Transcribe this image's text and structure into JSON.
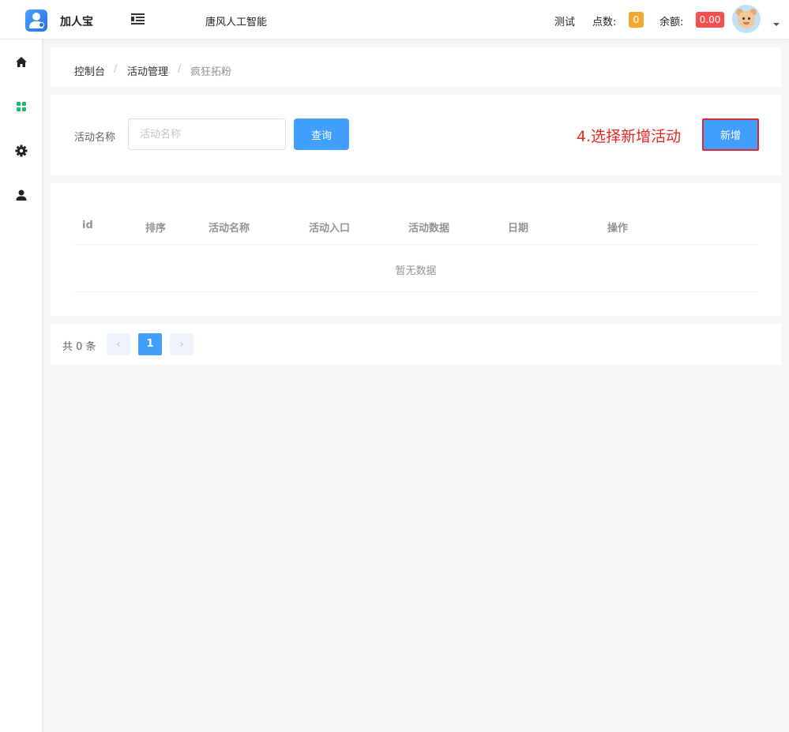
{
  "header": {
    "app_name": "加人宝",
    "org_name": "唐风人工智能",
    "user_name": "测试",
    "points_label": "点数:",
    "points_value": "0",
    "balance_label": "余额:",
    "balance_value": "0.00",
    "points_color": "#f0a830",
    "balance_color": "#f5504f"
  },
  "sidebar": {
    "items": [
      {
        "icon": "home-icon"
      },
      {
        "icon": "grid-icon",
        "active": true
      },
      {
        "icon": "gear-icon"
      },
      {
        "icon": "user-icon"
      }
    ],
    "active_color": "#19be6b"
  },
  "breadcrumb": {
    "items": [
      "控制台",
      "活动管理",
      "疯狂拓粉"
    ],
    "separator": "/"
  },
  "search": {
    "label": "活动名称",
    "placeholder": "活动名称",
    "value": "",
    "query_label": "查询",
    "annotation": "4.选择新增活动",
    "add_label": "新增"
  },
  "table": {
    "columns": [
      "id",
      "排序",
      "活动名称",
      "活动入口",
      "活动数据",
      "日期",
      "操作"
    ],
    "rows": [],
    "empty_text": "暂无数据"
  },
  "pagination": {
    "total_text": "共 0 条",
    "prev": "‹",
    "current": "1",
    "next": "›"
  },
  "accent_color": "#409eff"
}
